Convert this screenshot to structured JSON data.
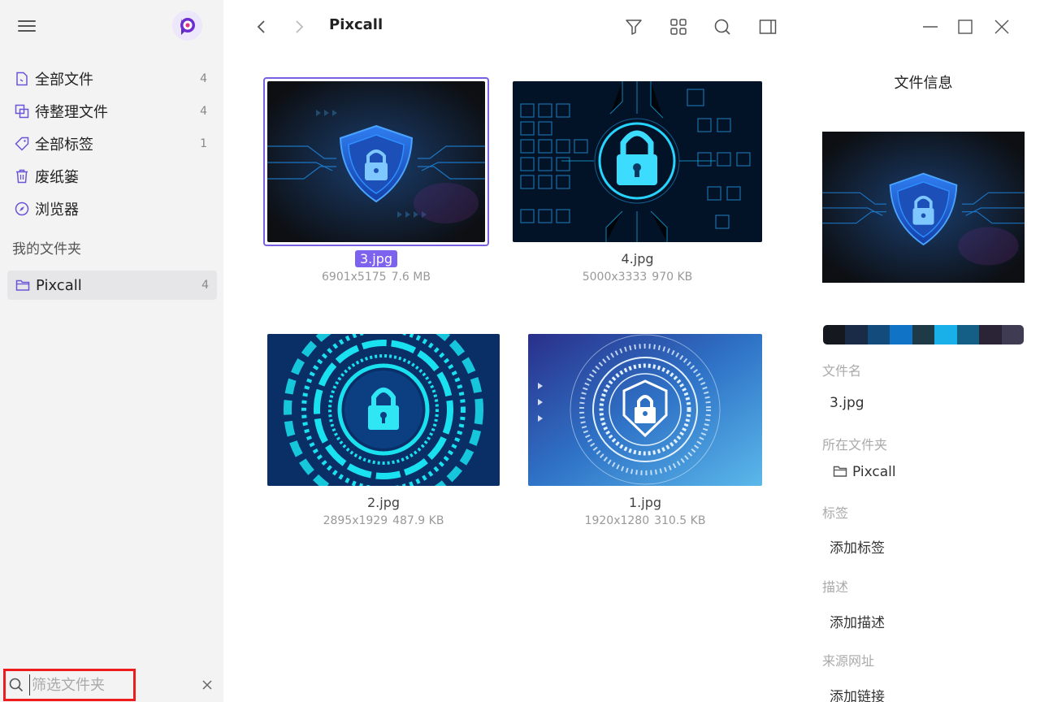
{
  "sidebar": {
    "nav": [
      {
        "label": "全部文件",
        "count": "4",
        "icon": "file-icon"
      },
      {
        "label": "待整理文件",
        "count": "4",
        "icon": "copy-icon"
      },
      {
        "label": "全部标签",
        "count": "1",
        "icon": "tag-icon"
      },
      {
        "label": "废纸篓",
        "count": "",
        "icon": "trash-icon"
      },
      {
        "label": "浏览器",
        "count": "",
        "icon": "compass-icon"
      }
    ],
    "folders_title": "我的文件夹",
    "folder": {
      "label": "Pixcall",
      "count": "4"
    },
    "search_placeholder": "筛选文件夹"
  },
  "toolbar": {
    "title": "Pixcall"
  },
  "files": [
    {
      "name": "3.jpg",
      "dims": "6901x5175",
      "size": "7.6 MB",
      "selected": true
    },
    {
      "name": "4.jpg",
      "dims": "5000x3333",
      "size": "970 KB",
      "selected": false
    },
    {
      "name": "2.jpg",
      "dims": "2895x1929",
      "size": "487.9 KB",
      "selected": false
    },
    {
      "name": "1.jpg",
      "dims": "1920x1280",
      "size": "310.5 KB",
      "selected": false
    }
  ],
  "info": {
    "title": "文件信息",
    "palette": [
      "#15191f",
      "#1a2b48",
      "#134b7c",
      "#1173c5",
      "#1e3a47",
      "#19afe9",
      "#135f86",
      "#2a2436",
      "#3e3b52"
    ],
    "filename_label": "文件名",
    "filename_value": "3.jpg",
    "folder_label": "所在文件夹",
    "folder_value": "Pixcall",
    "tags_label": "标签",
    "tags_value": "添加标签",
    "desc_label": "描述",
    "desc_value": "添加描述",
    "source_label": "来源网址",
    "source_value": "添加链接"
  },
  "colors": {
    "accent": "#7c62ec",
    "highlight": "#ee1c1c"
  }
}
